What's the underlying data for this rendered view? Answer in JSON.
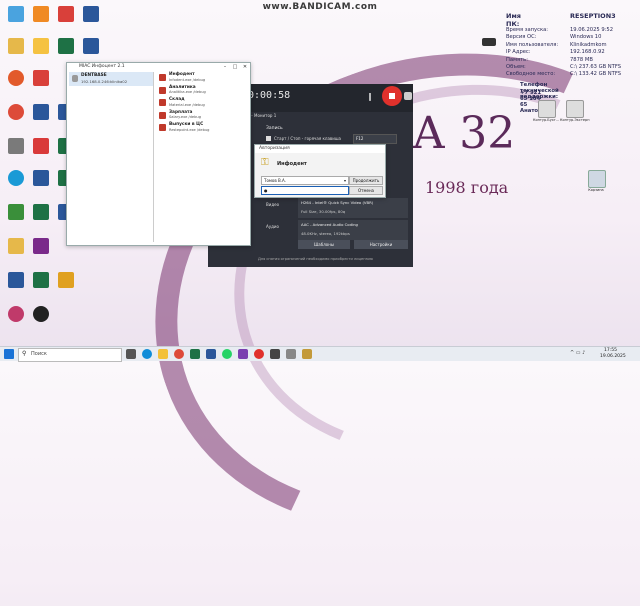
{
  "watermark": "www.BANDICAM.com",
  "desktop": {
    "big_text_partial": "А 32",
    "year_text": "1998 года"
  },
  "system_info": {
    "title_key": "Имя ПК:",
    "title_val": "RESEPTION3",
    "rows": [
      {
        "k": "Время запуска:",
        "v": "19.06.2025 9:52"
      },
      {
        "k": "Версия ОС:",
        "v": "Windows 10"
      },
      {
        "k": "Имя пользователя:",
        "v": "Klinikadmkom"
      },
      {
        "k": "IP Адрес:",
        "v": "192.168.0.92"
      },
      {
        "k": "Память:",
        "v": "7878 MB"
      },
      {
        "k": "Объем:",
        "v": "C:\\ 237.63 GB NTFS"
      },
      {
        "k": "Свободное место:",
        "v": "C:\\ 133.42 GB NTFS"
      }
    ],
    "support_label": "Телефон технической поддержки:",
    "support_phone": "+7 921 65 104 65 Анатолий"
  },
  "desktop_icons_right": [
    {
      "label": "Контур.Бухг..."
    },
    {
      "label": "Контур.Экстерн"
    },
    {
      "label": "Корзина"
    }
  ],
  "launcher": {
    "title": "MIAC Инфоцент 2.1",
    "server_name": "DENTBASE",
    "server_ip": "192.168.0.246:klinika02",
    "apps": [
      {
        "name": "Инфодент",
        "path": "Infodent.exe /debug"
      },
      {
        "name": "Аналитика",
        "path": "Analitika.exe /debug"
      },
      {
        "name": "Склад",
        "path": "Material.exe /debug"
      },
      {
        "name": "Зарплата",
        "path": "Salary.exe /debug"
      },
      {
        "name": "Выпуски в ЦС",
        "path": "Restepoint.exe /debug"
      }
    ]
  },
  "bandicam": {
    "time": "0:00:58",
    "size_label": "(1920, 1080) - Монитор 1",
    "section_hotkey": "Запись",
    "hotkey_label": "Старт / Стоп - горячая клавиша",
    "hotkey_value": "F12",
    "video_label": "Видео",
    "video_value": "H264 - Intel® Quick Sync Video (VBR)",
    "video_detail": "Full Size, 30.00fps, 80q",
    "audio_label": "Аудио",
    "audio_value": "AAC - Advanced Audio Coding",
    "audio_detail": "48.0KHz, stereo, 192kbps",
    "templates_button": "Шаблоны",
    "settings_button": "Настройки",
    "footer_text": "Для снятия ограничений необходимо приобрести лицензию",
    "brand": "BANDICUT"
  },
  "auth_dialog": {
    "title": "Авторизация",
    "app_name": "Инфодент",
    "user_value": "Томов В.А.",
    "password_value": "●",
    "continue_button": "Продолжить",
    "cancel_button": "Отмена"
  },
  "taskbar": {
    "search_placeholder": "Поиск",
    "time": "17:55",
    "date": "19.06.2025"
  },
  "colors": {
    "accent_blue": "#1a5fb4",
    "bandicam_red": "#e0312c",
    "info_text": "#2a2a55",
    "year_text": "#6a2a58"
  }
}
